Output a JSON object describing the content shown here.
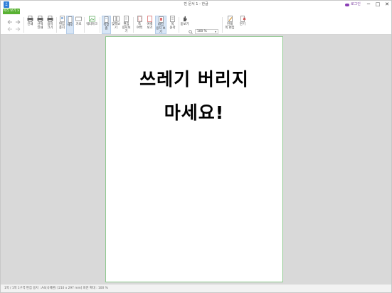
{
  "titlebar": {
    "app_icon_glyph": "ﾆ",
    "title": "빈 문서 1 - 한글",
    "login_label": "로그인",
    "minimize": "─",
    "maximize": "□",
    "close": "✕"
  },
  "tabs": [
    {
      "label": "미리 보기 ×"
    }
  ],
  "ribbon": {
    "undo_icon": "undo-icon",
    "redo_icon": "redo-icon",
    "buttons": [
      {
        "label": "인쇄"
      },
      {
        "label": "선택\n인쇄"
      },
      {
        "label": "용지\n크기"
      },
      {
        "label": "편집\n용지"
      },
      {
        "label": "세로"
      },
      {
        "label": "가로"
      },
      {
        "label": "워터마크"
      },
      {
        "label": "쪽맞춤"
      },
      {
        "label": "맞쪽보기"
      },
      {
        "label": "편집\n용지보기"
      },
      {
        "label": "쪽\n여백"
      },
      {
        "label": "여백\n보기"
      },
      {
        "label": "편집\n용지 보기"
      },
      {
        "label": "쪽\n윤곽"
      },
      {
        "label": "돋보기"
      },
      {
        "label": "현재\n쪽 편집"
      },
      {
        "label": "닫기"
      }
    ],
    "zoom_value": "100 %"
  },
  "document": {
    "line1": "쓰레기 버리지",
    "line2": "마세요!"
  },
  "statusbar": {
    "text": "1쪽 / 1쪽  1구역  편집 용지 : A4(국배판) [210 x 297 mm]  화면 확대 : 100 %"
  }
}
